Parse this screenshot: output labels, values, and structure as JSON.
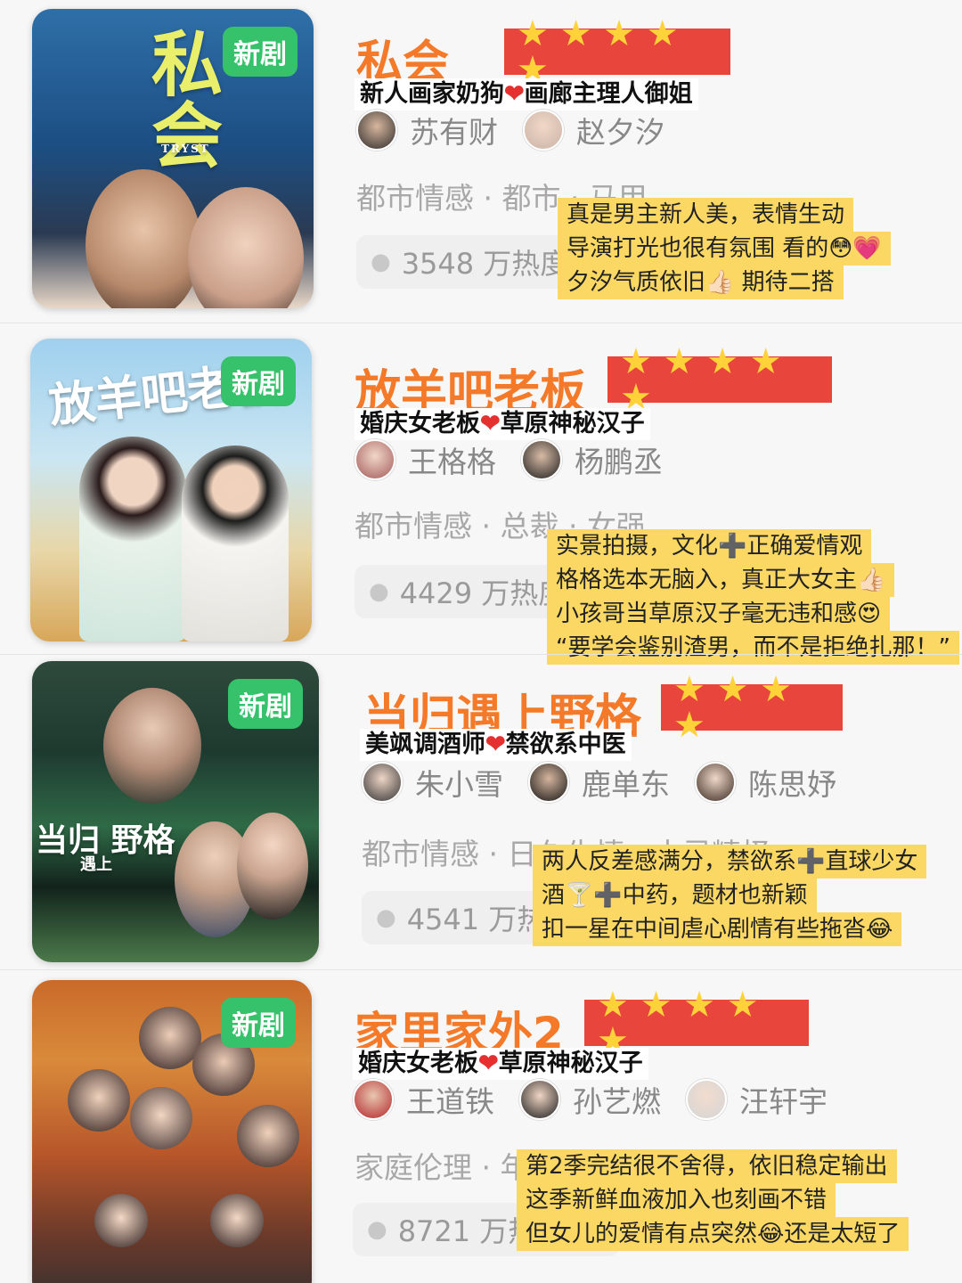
{
  "badge_label": "新剧",
  "colors": {
    "title": "#f47a2a",
    "stars_bg": "#e8453c",
    "star": "#ffd23a",
    "comment_bg": "#fbd864",
    "badge_bg": "#36c26a"
  },
  "shows": [
    {
      "title": "私会",
      "poster_title": "私会",
      "poster_subtitle": "TRYST",
      "rating_stars": 5,
      "stars": "★ ★ ★ ★ ★",
      "tagline_left": "新人画家奶狗",
      "tagline_right": "画廊主理人御姐",
      "cast": [
        "苏有财",
        "赵夕汐"
      ],
      "genre": "都市情感 · 都市 · 马甲",
      "heat": "3548 万热度",
      "comments": [
        "真是男主新人美，表情生动",
        "导演打光也很有氛围 看的😳💗",
        "夕汐气质依旧👍🏻 期待二搭"
      ]
    },
    {
      "title": "放羊吧老板",
      "poster_title": "放羊吧老板",
      "rating_stars": 5,
      "stars": "★ ★ ★ ★ ★",
      "tagline_left": "婚庆女老板",
      "tagline_right": "草原神秘汉子",
      "cast": [
        "王格格",
        "杨鹏丞"
      ],
      "genre": "都市情感 · 总裁 · 女强",
      "heat": "4429 万热度",
      "comments": [
        "实景拍摄，文化➕正确爱情观",
        "格格选本无脑入，真正大女主👍🏻",
        "小孩哥当草原汉子毫无违和感😍",
        "“要学会鉴别渣男，而不是拒绝扎那！”"
      ]
    },
    {
      "title": "当归遇上野格",
      "poster_title": "当归 野格",
      "poster_sub": "遇上",
      "rating_stars": 4,
      "stars": "★ ★ ★ ★",
      "tagline_left": "美飒调酒师",
      "tagline_right": "禁欲系中医",
      "cast": [
        "朱小雪",
        "鹿单东",
        "陈思妤"
      ],
      "genre": "都市情感 · 日久生情 · 古灵精怪",
      "heat": "4541 万热度",
      "comments": [
        "两人反差感满分，禁欲系➕直球少女",
        "酒🍸➕中药，题材也新颖",
        "扣一星在中间虐心剧情有些拖沓😂"
      ]
    },
    {
      "title": "家里家外2",
      "rating_stars": 5,
      "stars": "★ ★ ★ ★ ★",
      "tagline_left": "婚庆女老板",
      "tagline_right": "草原神秘汉子",
      "cast": [
        "王道铁",
        "孙艺燃",
        "汪轩宇"
      ],
      "genre": "家庭伦理 · 年代 · 家长里短",
      "heat": "8721 万热度",
      "comments": [
        "第2季完结很不舍得，依旧稳定输出",
        "这季新鲜血液加入也刻画不错",
        "但女儿的爱情有点突然😂还是太短了"
      ]
    }
  ]
}
